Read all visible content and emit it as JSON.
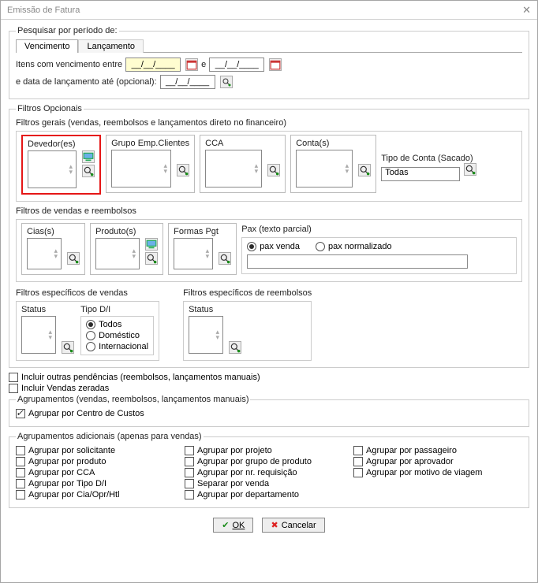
{
  "window": {
    "title": "Emissão de Fatura"
  },
  "period": {
    "group": "Pesquisar por período de:",
    "tab_venc": "Vencimento",
    "tab_lanc": "Lançamento",
    "line1_a": "Itens com vencimento entre",
    "date_mask": "__/__/____",
    "e": "e",
    "line2_a": "e data de lançamento até (opcional):"
  },
  "optional": {
    "group": "Filtros Opcionais",
    "gerais": {
      "legend": "Filtros gerais (vendas, reembolsos e lançamentos direto no financeiro)",
      "devedores": "Devedor(es)",
      "grupo": "Grupo Emp.Clientes",
      "cca": "CCA",
      "contas": "Conta(s)",
      "tipoconta_lbl": "Tipo de Conta (Sacado)",
      "tipoconta_val": "Todas"
    },
    "vendas_reemb": {
      "legend": "Filtros de vendas e reembolsos",
      "cias": "Cias(s)",
      "produtos": "Produto(s)",
      "formas": "Formas Pgt",
      "pax_lbl": "Pax (texto parcial)",
      "pax_venda": "pax venda",
      "pax_norm": "pax normalizado"
    },
    "esp_vendas": {
      "legend": "Filtros específicos de vendas",
      "status": "Status",
      "tipo_di": "Tipo D/I",
      "todos": "Todos",
      "dom": "Doméstico",
      "int": "Internacional"
    },
    "esp_reemb": {
      "legend": "Filtros específicos de reembolsos",
      "status": "Status"
    }
  },
  "checks": {
    "outras": "Incluir outras pendências (reembolsos, lançamentos manuais)",
    "zeradas": "Incluir Vendas zeradas"
  },
  "agrup": {
    "legend": "Agrupamentos (vendas, reembolsos, lançamentos manuais)",
    "centro": "Agrupar por Centro de Custos"
  },
  "agrup_add": {
    "legend": "Agrupamentos adicionais (apenas para vendas)",
    "c1": [
      "Agrupar por solicitante",
      "Agrupar por produto",
      "Agrupar por CCA",
      "Agrupar por Tipo D/I",
      "Agrupar por Cia/Opr/Htl"
    ],
    "c2": [
      "Agrupar por projeto",
      "Agrupar por grupo de produto",
      "Agrupar por nr. requisição",
      "Separar por venda",
      "Agrupar por departamento"
    ],
    "c3": [
      "Agrupar por passageiro",
      "Agrupar por aprovador",
      "Agrupar por motivo de viagem"
    ]
  },
  "buttons": {
    "ok": "OK",
    "cancel": "Cancelar"
  }
}
